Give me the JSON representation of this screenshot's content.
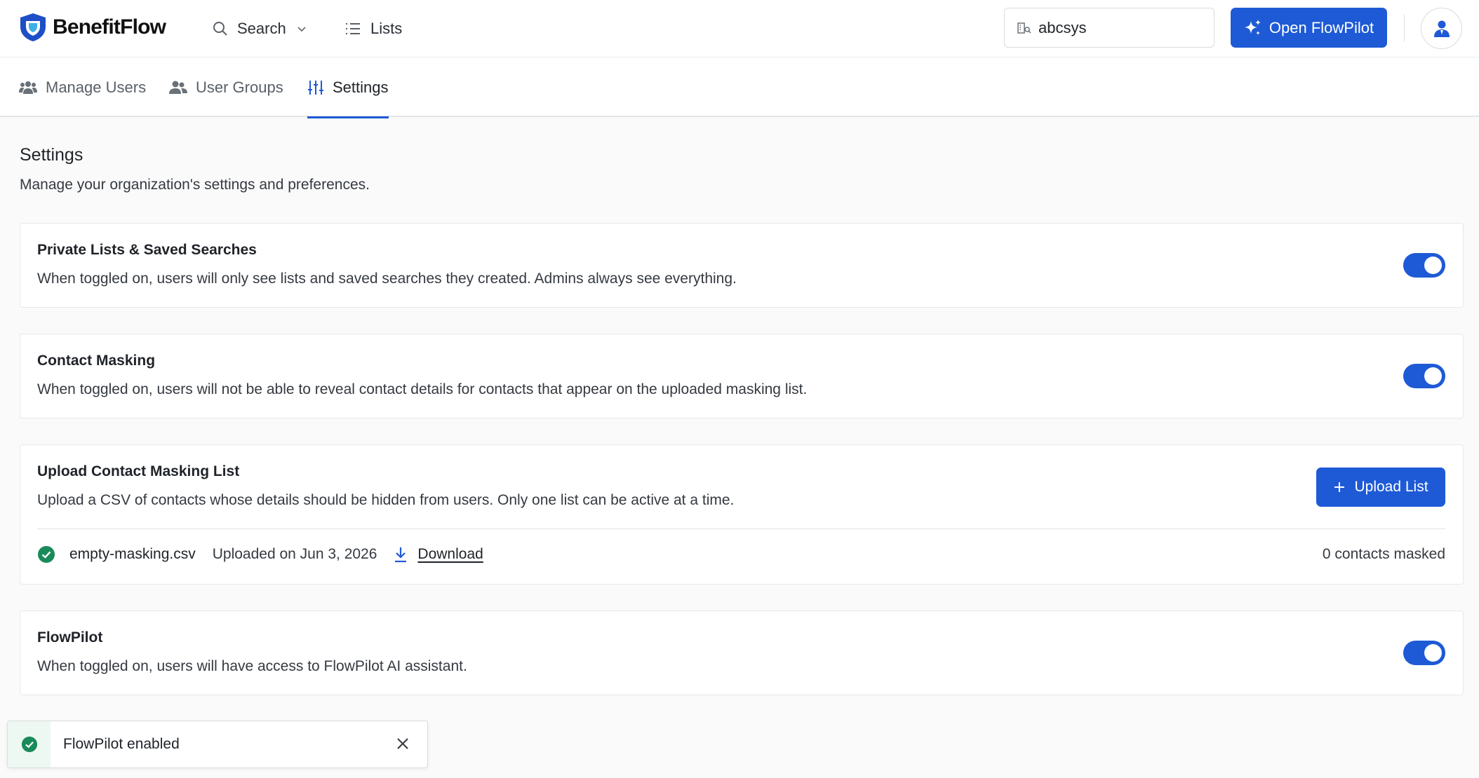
{
  "app": {
    "brand_name": "BenefitFlow",
    "accent_color": "#1e5ad6",
    "success_color": "#1a8a5a"
  },
  "nav": {
    "search_label": "Search",
    "lists_label": "Lists"
  },
  "org_switcher": {
    "value": "abcsys"
  },
  "flowpilot_button": {
    "label": "Open FlowPilot"
  },
  "tabs": [
    {
      "label": "Manage Users",
      "icon": "users-icon",
      "active": false
    },
    {
      "label": "User Groups",
      "icon": "user-group-icon",
      "active": false
    },
    {
      "label": "Settings",
      "icon": "sliders-icon",
      "active": true
    }
  ],
  "page": {
    "title": "Settings",
    "subtitle": "Manage your organization's settings and preferences."
  },
  "settings": {
    "private_lists": {
      "title": "Private Lists & Saved Searches",
      "description": "When toggled on, users will only see lists and saved searches they created. Admins always see everything.",
      "enabled": true
    },
    "contact_masking": {
      "title": "Contact Masking",
      "description": "When toggled on, users will not be able to reveal contact details for contacts that appear on the uploaded masking list.",
      "enabled": true
    },
    "upload_masking": {
      "title": "Upload Contact Masking List",
      "description": "Upload a CSV of contacts whose details should be hidden from users. Only one list can be active at a time.",
      "button_label": "Upload List",
      "file": {
        "name": "empty-masking.csv",
        "uploaded": "Uploaded on Jun 3, 2026",
        "download_label": "Download",
        "masked_count": "0 contacts masked"
      }
    },
    "flowpilot": {
      "title": "FlowPilot",
      "description": "When toggled on, users will have access to FlowPilot AI assistant.",
      "enabled": true
    }
  },
  "toast": {
    "message": "FlowPilot enabled"
  }
}
